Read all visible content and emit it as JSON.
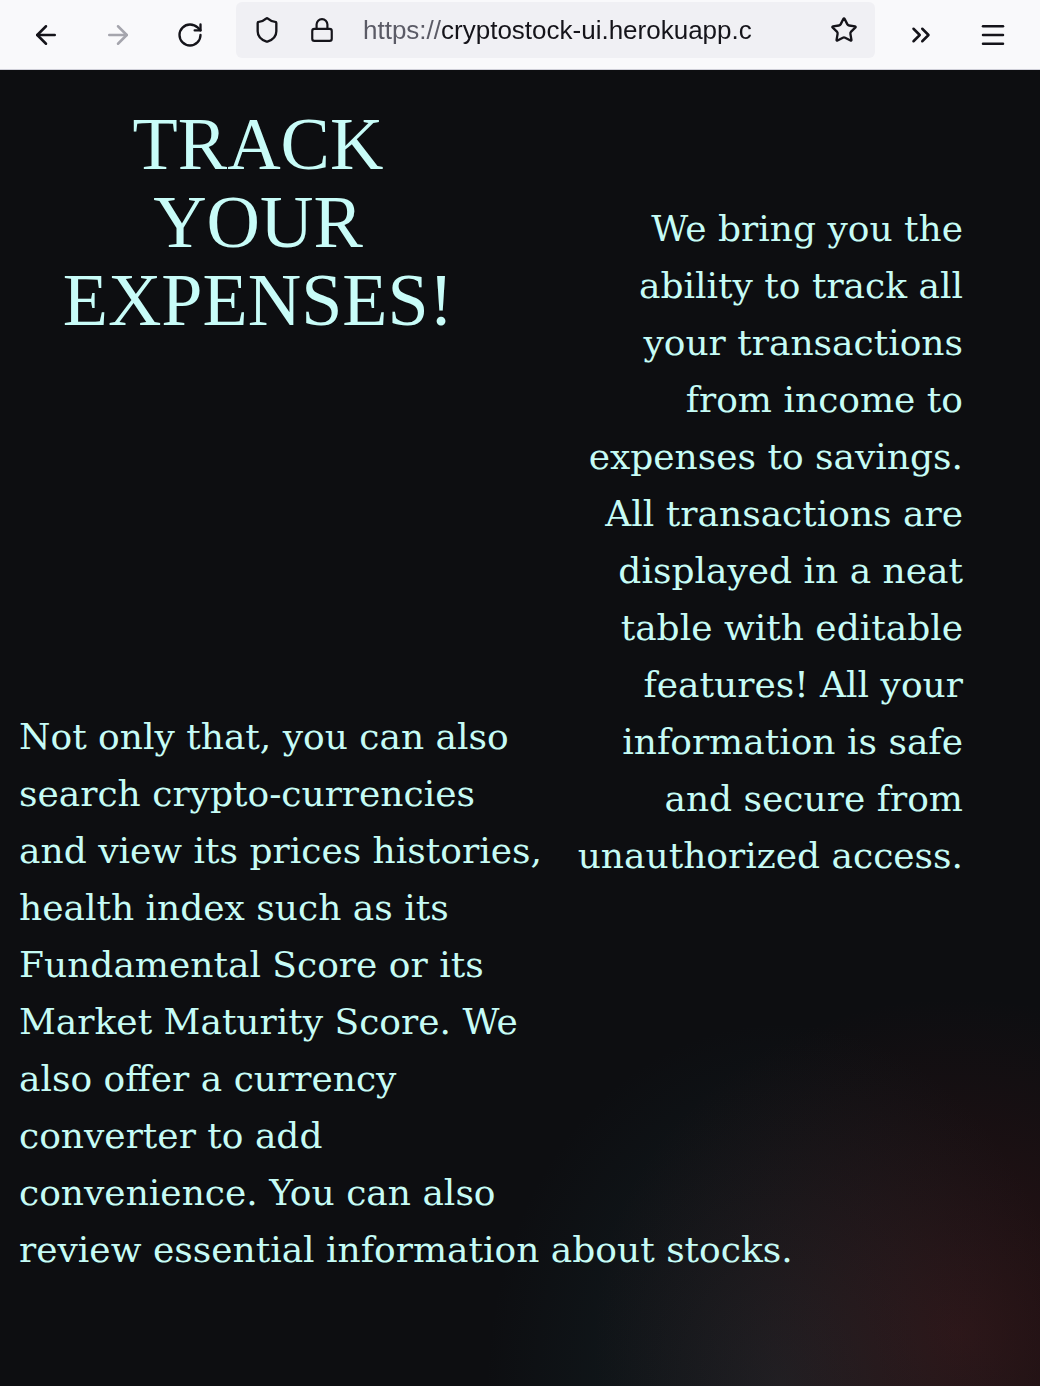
{
  "browser": {
    "back_enabled": true,
    "forward_enabled": false,
    "url": {
      "scheme": "https://",
      "rest": "cryptostock-ui.herokuapp.c"
    }
  },
  "page": {
    "title": "TRACK YOUR EXPENSES!",
    "intro": "We bring you the ability to track all your transactions from income to expenses to savings. All transactions are displayed in a neat table with editable features! All your information is safe and secure from unauthorized access.",
    "details": "Not only that, you can also search crypto-currencies and view its prices histories, health index such as its Fundamental Score or its Market Maturity Score. We also offer a currency converter to add convenience. You can also review essential information about stocks."
  }
}
